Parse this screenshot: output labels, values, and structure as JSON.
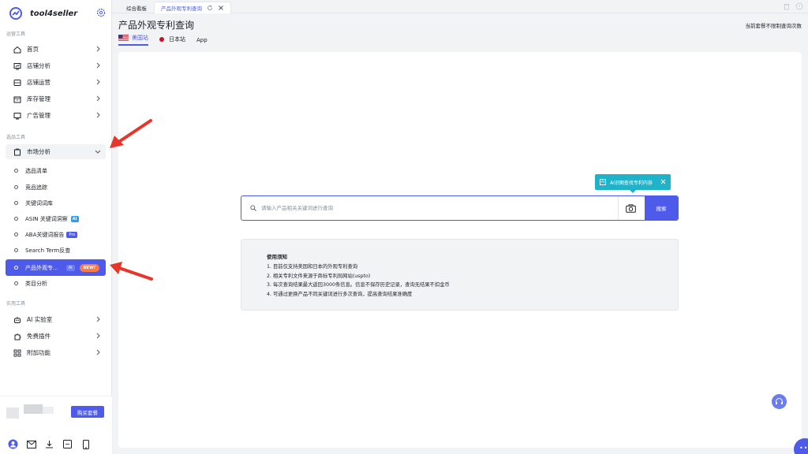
{
  "brand": {
    "name": "tool4seller",
    "logo_icon": "trend-logo-icon",
    "settings_icon": "gear-icon"
  },
  "sidebar": {
    "group_ops": "运营工具",
    "group_select": "选品工具",
    "group_util": "实用工具",
    "ops_items": [
      {
        "label": "首页",
        "icon": "home-icon"
      },
      {
        "label": "店铺分析",
        "icon": "store-analysis-icon"
      },
      {
        "label": "店铺运营",
        "icon": "store-ops-icon"
      },
      {
        "label": "库存管理",
        "icon": "inventory-icon"
      },
      {
        "label": "广告管理",
        "icon": "ads-icon"
      }
    ],
    "market": {
      "label": "市场分析",
      "icon": "market-icon"
    },
    "market_sub": [
      {
        "label": "选品清单"
      },
      {
        "label": "竞品追踪"
      },
      {
        "label": "关键词词库"
      },
      {
        "label": "ASIN 关键词洞察",
        "tag": "AI"
      },
      {
        "label": "ABA关键词报告",
        "tag": "Pro"
      },
      {
        "label": "Search Term反查"
      },
      {
        "label": "产品外观专...",
        "tag": "AI",
        "badge": "NEW!"
      },
      {
        "label": "类目分析"
      }
    ],
    "util_items": [
      {
        "label": "AI 实验室",
        "icon": "robot-icon"
      },
      {
        "label": "免费插件",
        "icon": "puzzle-icon"
      },
      {
        "label": "附加功能",
        "icon": "grid-icon"
      }
    ],
    "buy_label": "购买套餐",
    "bottom_icons": [
      "user-avatar-icon",
      "mail-icon",
      "download-icon",
      "en-language-icon",
      "mobile-icon"
    ]
  },
  "tabs": [
    {
      "label": "综合看板"
    },
    {
      "label": "产品外观专利查询"
    }
  ],
  "page": {
    "title": "产品外观专利查询",
    "plan_note": "当前套餐不限制查询次数",
    "sites": [
      {
        "label": "美国站"
      },
      {
        "label": "日本站"
      },
      {
        "label": "App"
      }
    ]
  },
  "search": {
    "ai_tip": "AI识图查找专利内容",
    "ai_badge": "AI",
    "placeholder": "请输入产品相关关键词进行查询",
    "value": "",
    "button": "搜索"
  },
  "notice": {
    "title": "使用须知",
    "lines": [
      "1. 目前仅支持美国和日本的外观专利查询",
      "2. 相关专利文件来源于商标专利局网站(uspto)",
      "3. 每次查询结果最大返回3000条信息。信息不保存历史记录，查询无结果不扣金币",
      "4. 可通过更换产品不同关键词进行多次查询，提高查询结果准确度"
    ]
  },
  "colors": {
    "accent": "#4e5bea",
    "tip": "#20b2c9",
    "new_badge": "#f97b4a",
    "arrow": "#e8352a"
  }
}
